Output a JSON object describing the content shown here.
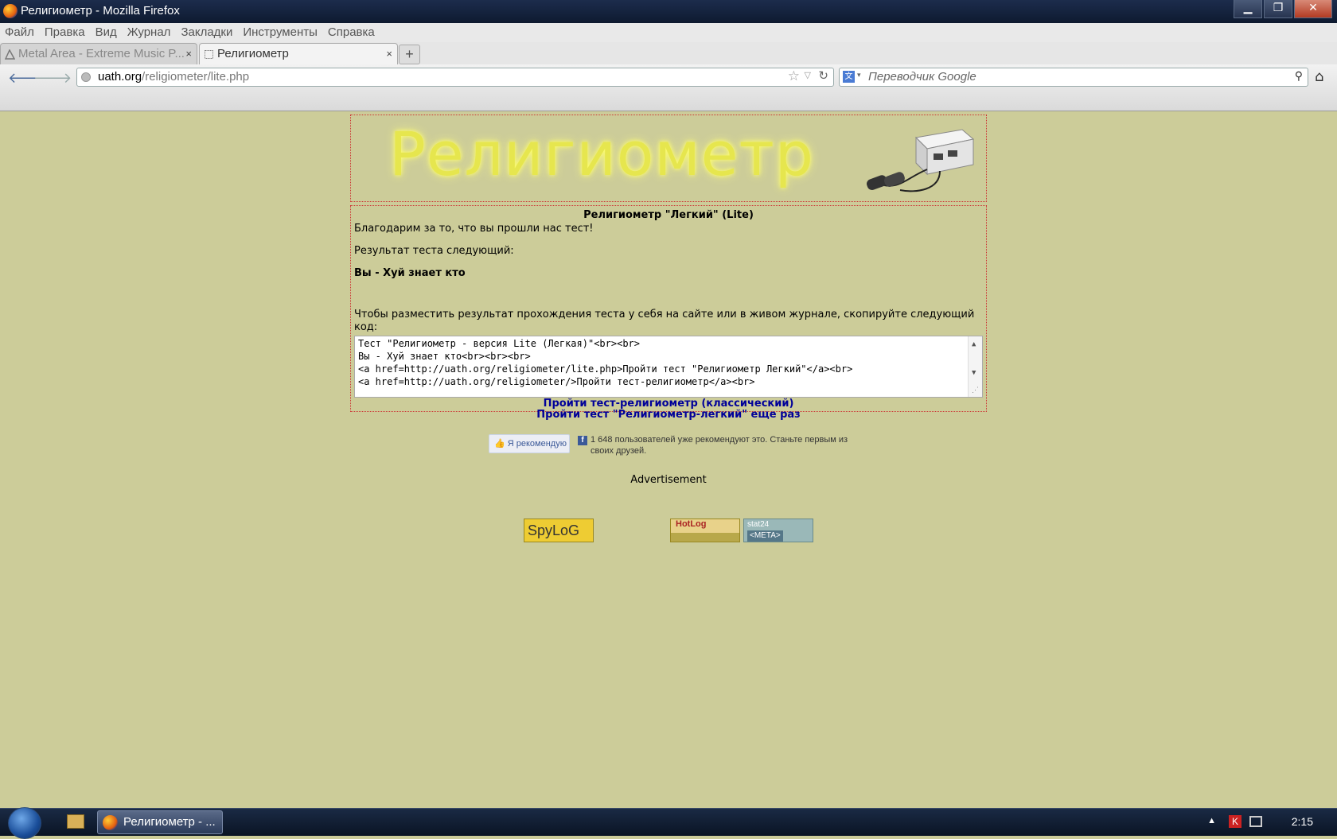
{
  "window": {
    "title": "Религиометр - Mozilla Firefox",
    "buttons": {
      "minimize": "▁",
      "maximize": "❐",
      "close": "✕"
    }
  },
  "menu": [
    "Файл",
    "Правка",
    "Вид",
    "Журнал",
    "Закладки",
    "Инструменты",
    "Справка"
  ],
  "tabs": [
    {
      "label": "Metal Area - Extreme Music P...",
      "active": false
    },
    {
      "label": "Религиометр",
      "active": true
    }
  ],
  "tab_close": "×",
  "new_tab": "+",
  "nav": {
    "back": "🡐",
    "forward": "🡒",
    "url_domain": "uath.org",
    "url_path": "/religiometer/lite.php",
    "star": "☆",
    "dropdown": "▽",
    "reload": "↻",
    "search_engine_icon": "文",
    "search_dropdown": "▾",
    "search_placeholder": "Переводчик Google",
    "search_icon": "⚲",
    "home": "⌂"
  },
  "page": {
    "logo_text": "Религиометр",
    "heading": "Религиометр \"Легкий\" (Lite)",
    "thanks": "Благодарим за то, что вы прошли нас тест!",
    "result_label": "Результат теста следующий:",
    "result": "Вы - Хуй знает кто",
    "instruction": "Чтобы разместить результат прохождения теста у себя на сайте или в живом журнале, скопируйте следующий код:",
    "code_lines": [
      "Тест \"Религиометр - версия Lite (Легкая)\"<br><br>",
      "Вы - Хуй знает кто<br><br><br>",
      "<a href=http://uath.org/religiometer/lite.php>Пройти тест \"Религиометр Легкий\"</a><br>",
      "<a href=http://uath.org/religiometer/>Пройти тест-религиометр</a><br>"
    ],
    "scroll_up": "▲",
    "scroll_down": "▼",
    "resize_grip": "⋰",
    "link_classic": "Пройти тест-религиометр (классический)",
    "link_again": "Пройти тест \"Религиометр-легкий\" еще раз",
    "fb_button": "Я рекомендую",
    "fb_logo": "f",
    "fb_text": "1 648 пользователей уже рекомендуют это. Станьте первым из своих друзей.",
    "advertisement": "Advertisement",
    "counter_spylog": "SpyLoG",
    "counter_hotlog": "HotLog",
    "counter_stat24": "stat24",
    "counter_meta": "<META>"
  },
  "taskbar": {
    "task_label": "Религиометр - ...",
    "tray_arrow": "▲",
    "tray_av": "K",
    "clock": "2:15"
  },
  "colors": {
    "page_bg": "#cccc99",
    "link": "#000099",
    "box_border": "#cc3333"
  }
}
